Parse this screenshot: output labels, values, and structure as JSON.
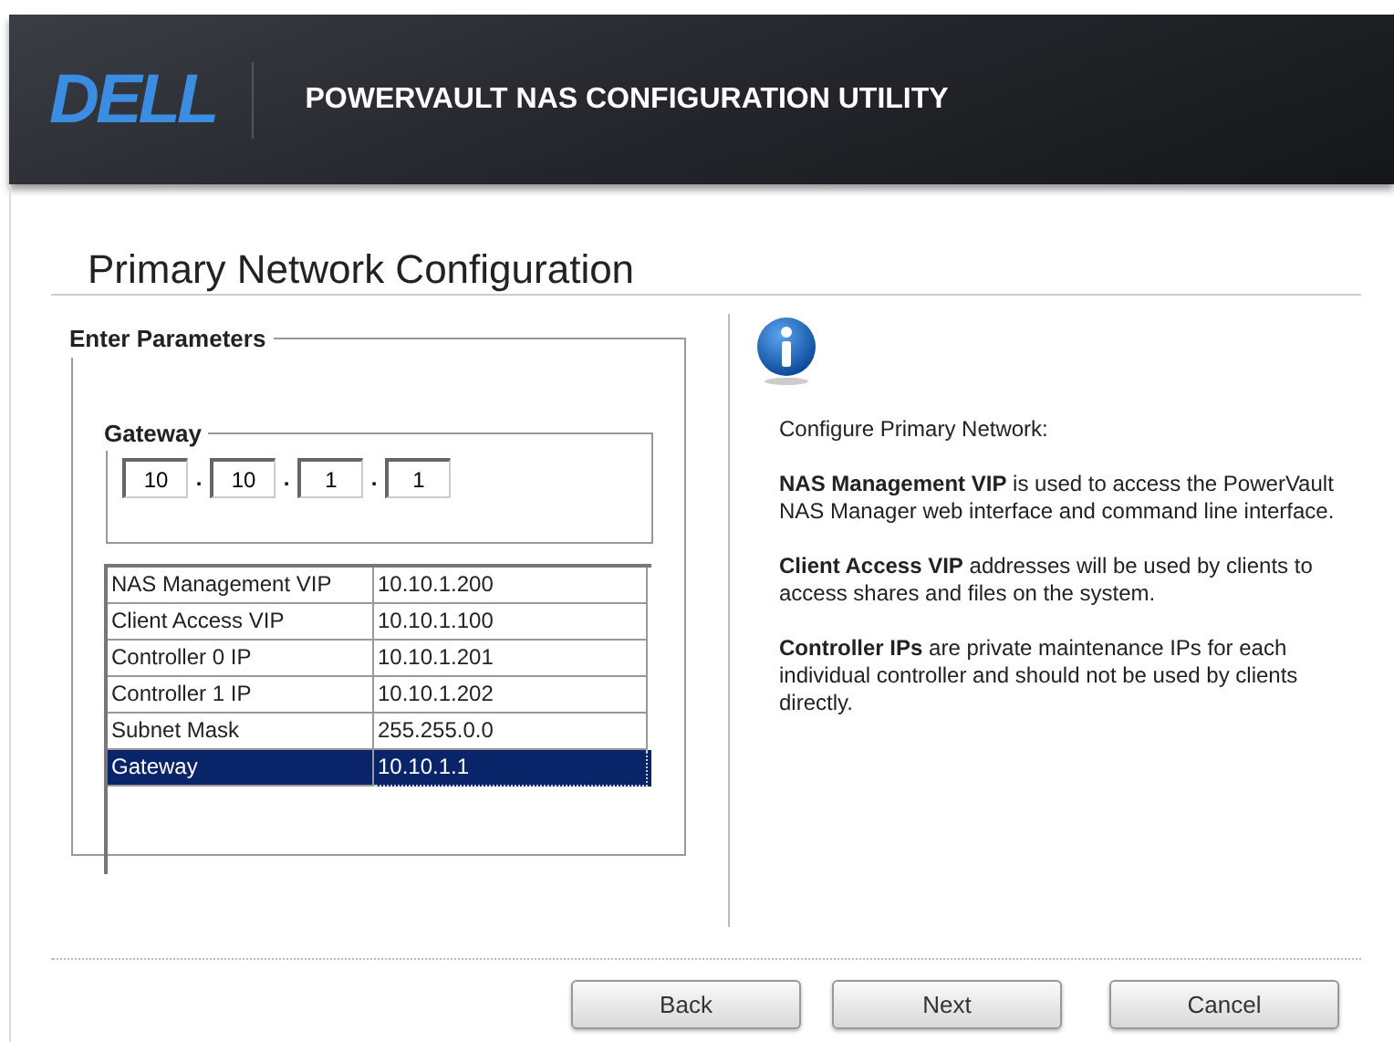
{
  "header": {
    "logo": "DELL",
    "title": "POWERVAULT NAS CONFIGURATION UTILITY"
  },
  "page_title": "Primary Network Configuration",
  "parameters": {
    "legend": "Enter Parameters",
    "gateway": {
      "legend": "Gateway",
      "octets": [
        "10",
        "10",
        "1",
        "1"
      ],
      "separator": "."
    },
    "rows": [
      {
        "name": "NAS Management VIP",
        "value": "10.10.1.200",
        "selected": false
      },
      {
        "name": "Client Access VIP",
        "value": "10.10.1.100",
        "selected": false
      },
      {
        "name": "Controller 0 IP",
        "value": "10.10.1.201",
        "selected": false
      },
      {
        "name": "Controller 1 IP",
        "value": "10.10.1.202",
        "selected": false
      },
      {
        "name": "Subnet Mask",
        "value": "255.255.0.0",
        "selected": false
      },
      {
        "name": "Gateway",
        "value": "10.10.1.1",
        "selected": true
      }
    ]
  },
  "info": {
    "paragraphs": [
      "Configure Primary Network:",
      "**NAS Management VIP** is used to access the PowerVault NAS Manager web interface and command line interface.",
      "**Client Access VIP** addresses will be used by clients to access shares and files on the system.",
      "**Controller IPs** are private maintenance IPs for each individual controller and should not be used by clients directly."
    ]
  },
  "buttons": [
    "Back",
    "Next",
    "Cancel"
  ]
}
